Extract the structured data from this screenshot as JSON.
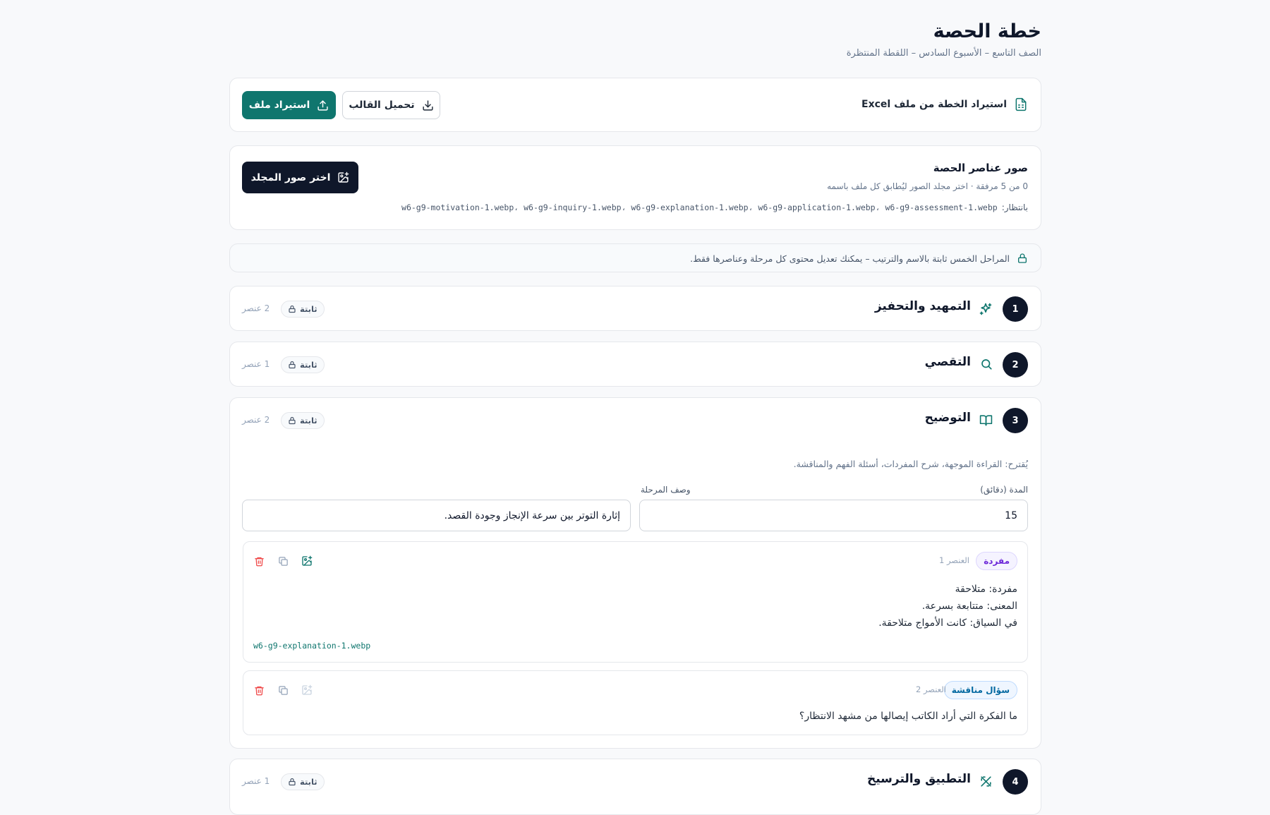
{
  "header": {
    "title": "خطة الحصة",
    "subtitle": "الصف التاسع – الأسبوع السادس – اللقطة المنتظرة"
  },
  "import": {
    "label": "استيراد الخطة من ملف Excel",
    "download_template": "تحميل القالب",
    "import_file": "استيراد ملف"
  },
  "images": {
    "title": "صور عناصر الحصة",
    "count": "0 من 5 مرفقة · اختر مجلد الصور ليُطابق كل ملف باسمه",
    "expect_label": "بانتظار:",
    "expect_files": "w6-g9-motivation-1.webp، w6-g9-inquiry-1.webp، w6-g9-explanation-1.webp، w6-g9-application-1.webp، w6-g9-assessment-1.webp",
    "choose_folder": "اختر صور المجلد"
  },
  "notice": {
    "text": "المراحل الخمس ثابتة بالاسم والترتيب – يمكنك تعديل محتوى كل مرحلة وعناصرها فقط."
  },
  "stages": [
    {
      "number": "1",
      "title": "التمهيد والتحفيز",
      "badge": "ثابتة",
      "count": "2 عنصر",
      "icon": "sparkles-icon"
    },
    {
      "number": "2",
      "title": "التقصي",
      "badge": "ثابتة",
      "count": "1 عنصر",
      "icon": "search-icon"
    },
    {
      "number": "3",
      "title": "التوضيح",
      "badge": "ثابتة",
      "count": "2 عنصر",
      "icon": "book-open-icon",
      "suggestion": "يُقترح: القراءة الموجهة، شرح المفردات، أسئلة الفهم والمناقشة.",
      "duration_label": "المدة (دقائق)",
      "duration_value": "15",
      "description_label": "وصف المرحلة",
      "description_value": "إثارة التوتر بين سرعة الإنجاز وجودة القصد.",
      "elements": [
        {
          "tag": "مفردة",
          "index": "العنصر 1",
          "lines": [
            "مفردة: متلاحقة",
            "المعنى: متتابعة بسرعة.",
            "في السياق: كانت الأمواج متلاحقة."
          ],
          "file": "w6-g9-explanation-1.webp"
        },
        {
          "tag": "سؤال مناقشة",
          "index": "العنصر 2",
          "lines": [
            "ما الفكرة التي أراد الكاتب إيصالها من مشهد الانتظار؟"
          ]
        }
      ]
    },
    {
      "number": "4",
      "title": "التطبيق والترسيخ",
      "badge": "ثابتة",
      "count": "1 عنصر",
      "icon": "puzzle-icon"
    }
  ],
  "colors": {
    "primary": "#0f766e",
    "dark": "#0f172a",
    "danger": "#ef4444",
    "tag_purple": "#6d28d9",
    "tag_blue": "#0369a1"
  }
}
